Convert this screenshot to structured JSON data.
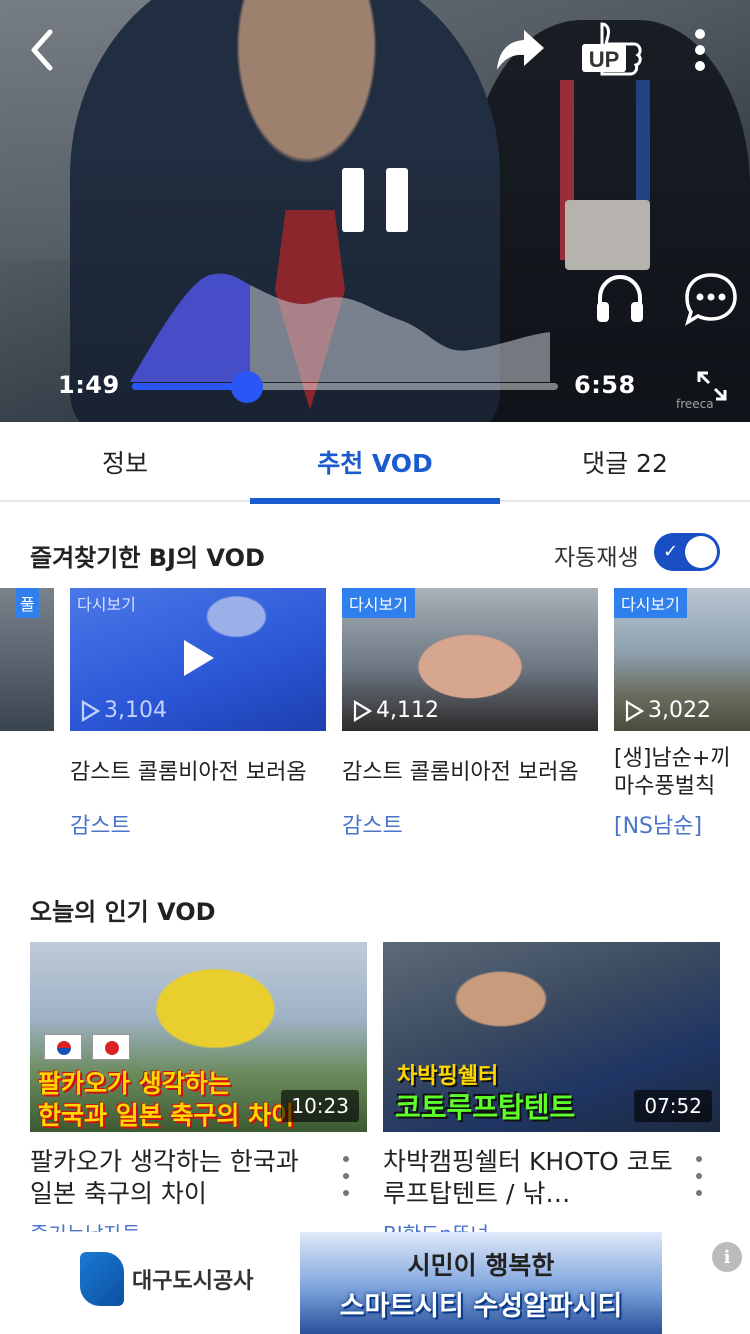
{
  "player": {
    "current_time": "1:49",
    "duration": "6:58",
    "progress": 0.27,
    "watermark": "freeca",
    "icons": [
      "back-icon",
      "share-icon",
      "up-icon",
      "more-vertical-icon",
      "pause-icon",
      "headphones-icon",
      "chat-icon",
      "fullscreen-icon"
    ],
    "up_label": "UP"
  },
  "tabs": [
    {
      "label": "정보",
      "active": false
    },
    {
      "label": "추천 VOD",
      "active": true
    },
    {
      "label": "댓글 22",
      "active": false
    }
  ],
  "favorite_section": {
    "title": "즐겨찾기한 BJ의 VOD",
    "autoplay_label": "자동재생",
    "autoplay_on": true,
    "cards": [
      {
        "tag": "다시보기",
        "views": "3,104",
        "title": "감스트 콜롬비아전 보러옴",
        "author": "감스트"
      },
      {
        "tag": "다시보기",
        "views": "4,112",
        "title": "감스트 콜롬비아전 보러옴",
        "author": "감스트"
      },
      {
        "tag": "다시보기",
        "views": "3,022",
        "title": "[생]남순+끼",
        "title2": "마수풍벌칙",
        "author": "[NS남순]"
      }
    ],
    "partial_card_tag": "풀"
  },
  "popular_section": {
    "title": "오늘의 인기 VOD",
    "cards": [
      {
        "duration": "10:23",
        "title": "팔카오가 생각하는 한국과 일본 축구의 차이",
        "author": "즐기는남자들",
        "caption_line1": "팔카오가 생각하는",
        "caption_line2": "한국과 일본 축구의 차이"
      },
      {
        "duration": "07:52",
        "title": "차박캠핑쉘터 KHOTO 코토 루프탑텐트 / 낚…",
        "author": "BJ한도n뚜녀",
        "caption_line1": "차박핑쉘터",
        "caption_line2": "코토루프탑텐트"
      }
    ]
  },
  "ad": {
    "logo_name": "대구도시공사",
    "line1": "시민이 행복한",
    "line2": "스마트시티 수성알파시티",
    "info_glyph": "i"
  },
  "colors": {
    "accent": "#1a5bd0",
    "seek": "#2a56f5",
    "replay_tag": "#2f80ed",
    "author": "#4a74c9"
  }
}
